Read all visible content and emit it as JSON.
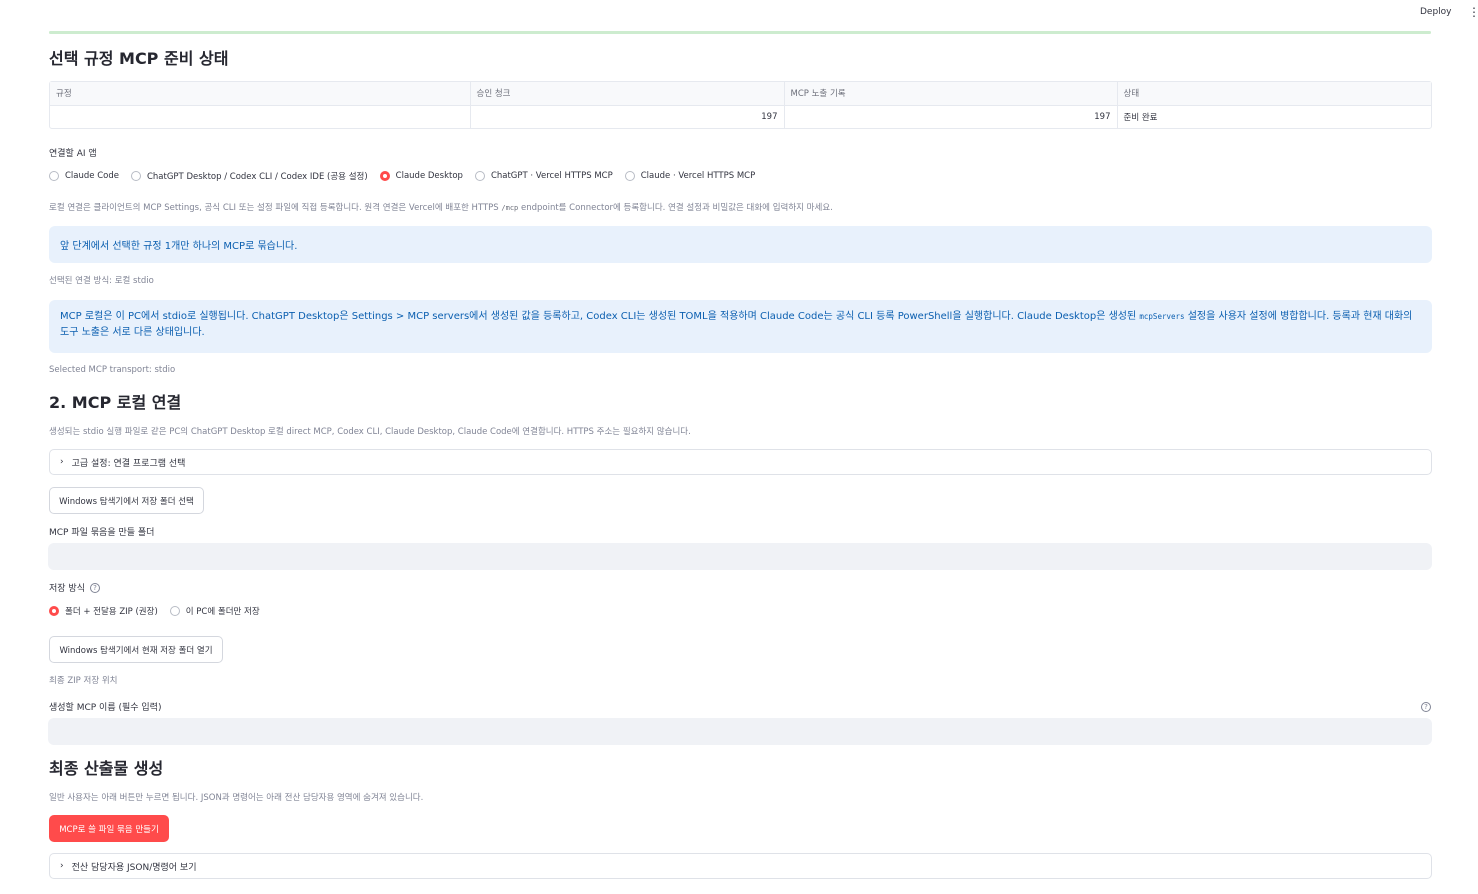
{
  "header": {
    "deploy_label": "Deploy",
    "menu_icon": "vertical-dots-icon"
  },
  "progress": {
    "fraction": 1.0
  },
  "section1": {
    "title": "선택 규정 MCP 준비 상태",
    "table": {
      "columns": [
        "규정",
        "승인 청크",
        "MCP 노출 기록",
        "상태"
      ],
      "rows": [
        {
          "rule": "",
          "chunks": "197",
          "records": "197",
          "status": "준비 완료"
        }
      ]
    }
  },
  "app_select": {
    "label": "연결할 AI 앱",
    "options": [
      {
        "label": "Claude Code",
        "selected": false
      },
      {
        "label": "ChatGPT Desktop / Codex CLI / Codex IDE (공용 설정)",
        "selected": false
      },
      {
        "label": "Claude Desktop",
        "selected": true
      },
      {
        "label": "ChatGPT · Vercel HTTPS MCP",
        "selected": false
      },
      {
        "label": "Claude · Vercel HTTPS MCP",
        "selected": false
      }
    ],
    "help_part1": "로컬 연결은 클라이언트의 MCP Settings, 공식 CLI 또는 설정 파일에 직접 등록합니다. 원격 연결은 Vercel에 배포한 HTTPS",
    "help_code": "/mcp",
    "help_part2": "endpoint를 Connector에 등록합니다. 연결 설정과 비밀값은 대화에 입력하지 마세요."
  },
  "info_bundle": "앞 단계에서 선택한 규정 1개만 하나의 MCP로 묶습니다.",
  "selected_method": "선택된 연결 방식: 로컬 stdio",
  "info_local": {
    "part1": "MCP 로컬은 이 PC에서 stdio로 실행됩니다. ChatGPT Desktop은 Settings > MCP servers에서 생성된 값을 등록하고, Codex CLI는 생성된 TOML을 적용하며 Claude Code는 공식 CLI 등록 PowerShell을 실행합니다. Claude Desktop은 생성된",
    "code": "mcpServers",
    "part2": "설정을 사용자 설정에 병합합니다. 등록과 현재 대화의 도구 노출은 서로 다른 상태입니다."
  },
  "transport_caption": "Selected MCP transport: stdio",
  "section2": {
    "title": "2. MCP 로컬 연결",
    "desc": "생성되는 stdio 실행 파일로 같은 PC의 ChatGPT Desktop 로컬 direct MCP, Codex CLI, Claude Desktop, Claude Code에 연결합니다. HTTPS 주소는 필요하지 않습니다.",
    "advanced_label": "고급 설정: 연결 프로그램 선택",
    "pick_folder_button": "Windows 탐색기에서 저장 폴더 선택",
    "folder_label": "MCP 파일 묶음을 만들 폴더",
    "folder_value": "",
    "save_mode_label": "저장 방식",
    "save_modes": [
      {
        "label": "폴더 + 전달용 ZIP (권장)",
        "selected": true
      },
      {
        "label": "이 PC에 폴더만 저장",
        "selected": false
      }
    ],
    "open_folder_button": "Windows 탐색기에서 현재 저장 폴더 열기",
    "zip_location_caption": "최종 ZIP 저장 위치",
    "mcp_name_label": "생성할 MCP 이름 (필수 입력)",
    "mcp_name_value": ""
  },
  "section3": {
    "title": "최종 산출물 생성",
    "desc": "일반 사용자는 아래 버튼만 누르면 됩니다. JSON과 명령어는 아래 전산 담당자용 영역에 숨겨져 있습니다.",
    "primary_button": "MCP로 쓸 파일 묶음 만들기",
    "advanced_label": "전산 담당자용 JSON/명령어 보기"
  },
  "colors": {
    "accent": "#ff4b4b",
    "info_bg": "#e8f1fc",
    "info_text": "#0b5fb0"
  }
}
